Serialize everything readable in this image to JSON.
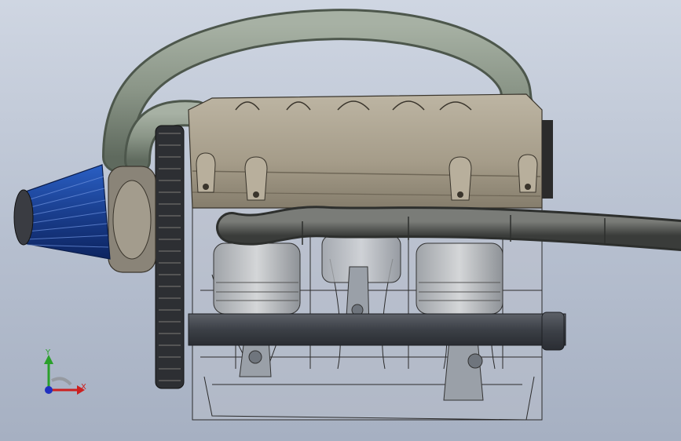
{
  "viewport": {
    "background_top": "#cfd6e2",
    "background_bottom": "#a6b0c2"
  },
  "model": {
    "intake_pipe_color": "#8b9687",
    "air_filter_color": "#1f4fa8",
    "block_color": "#a89f8c",
    "hose_color": "#5c5e5c",
    "wireframe_color": "#2b2b2b"
  },
  "triad": {
    "x_label": "X",
    "y_label": "Y",
    "x_color": "#cc2020",
    "y_color": "#2aa02a",
    "z_color": "#2030c0"
  }
}
